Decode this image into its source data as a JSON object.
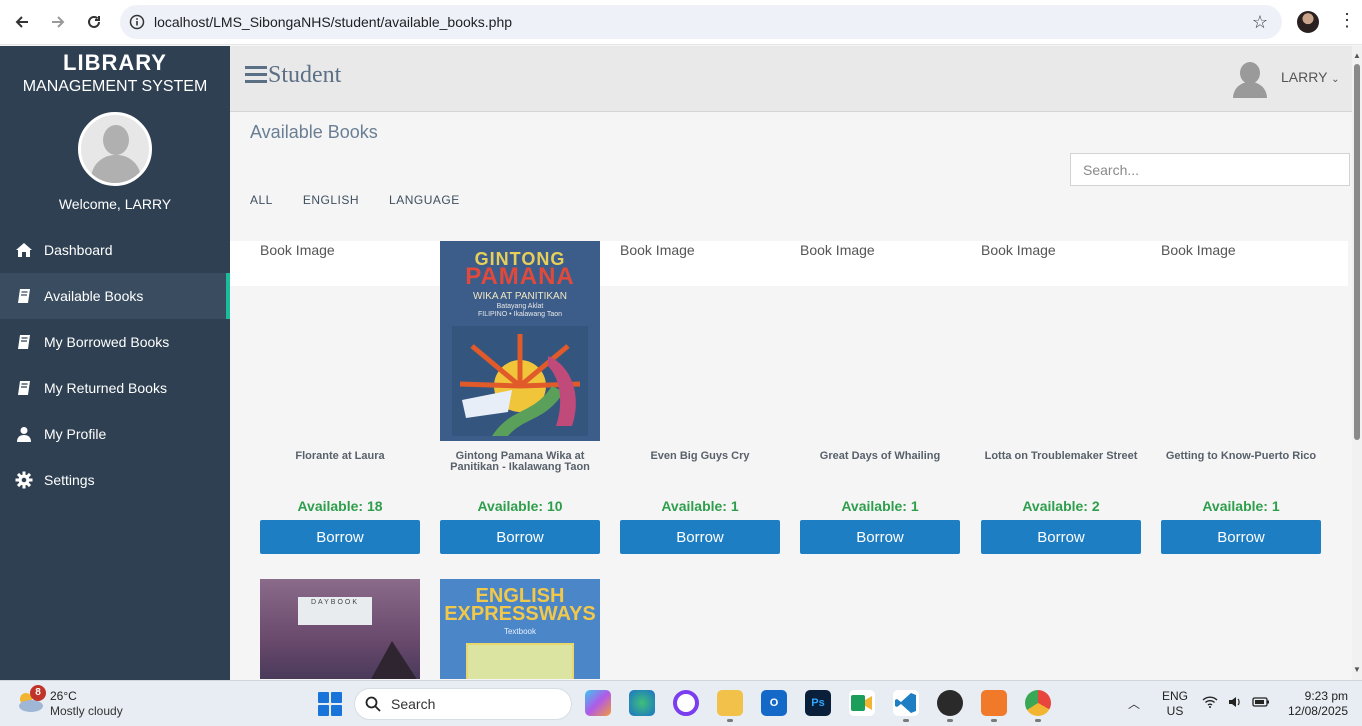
{
  "browser": {
    "url": "localhost/LMS_SibongaNHS/student/available_books.php"
  },
  "sidebar": {
    "brand_title": "LIBRARY",
    "brand_subtitle": "MANAGEMENT SYSTEM",
    "welcome": "Welcome, LARRY",
    "items": [
      {
        "label": "Dashboard",
        "icon": "home-icon",
        "active": false
      },
      {
        "label": "Available Books",
        "icon": "book-icon",
        "active": true
      },
      {
        "label": "My Borrowed Books",
        "icon": "book-icon",
        "active": false
      },
      {
        "label": "My Returned Books",
        "icon": "book-icon",
        "active": false
      },
      {
        "label": "My Profile",
        "icon": "user-icon",
        "active": false
      },
      {
        "label": "Settings",
        "icon": "gear-icon",
        "active": false
      }
    ]
  },
  "header": {
    "title": "Student",
    "user_name": "LARRY"
  },
  "main": {
    "page_title": "Available Books",
    "search_placeholder": "Search...",
    "filters": [
      "ALL",
      "ENGLISH",
      "LANGUAGE"
    ],
    "broken_image_alt": "Book Image",
    "borrow_label": "Borrow",
    "books": [
      {
        "title": "Florante at Laura",
        "available": "Available: 18",
        "cover": "broken"
      },
      {
        "title": "Gintong Pamana Wika at Panitikan - Ikalawang Taon",
        "available": "Available: 10",
        "cover": "gintong-pamana"
      },
      {
        "title": "Even Big Guys Cry",
        "available": "Available: 1",
        "cover": "broken"
      },
      {
        "title": "Great Days of Whailing",
        "available": "Available: 1",
        "cover": "broken"
      },
      {
        "title": "Lotta on Troublemaker Street",
        "available": "Available: 2",
        "cover": "broken"
      },
      {
        "title": "Getting to Know-Puerto Rico",
        "available": "Available: 1",
        "cover": "broken"
      }
    ],
    "covers": {
      "gintong_pamana": {
        "line1": "GINTONG",
        "line2": "PAMANA",
        "line3": "WIKA AT PANITIKAN",
        "line4": "Batayang Aklat",
        "line5": "FILIPINO • Ikalawang Taon"
      },
      "daybook": {
        "label": "DAYBOOK"
      },
      "english_expressways": {
        "line1": "ENGLISH",
        "line2": "EXPRESSWAYS",
        "line3": "Textbook"
      }
    }
  },
  "taskbar": {
    "weather_badge": "8",
    "temperature": "26°C",
    "weather_desc": "Mostly cloudy",
    "search_label": "Search",
    "lang_line1": "ENG",
    "lang_line2": "US",
    "time": "9:23 pm",
    "date": "12/08/2025"
  },
  "colors": {
    "sidebar_bg": "#2e4052",
    "accent": "#1abc9c",
    "borrow_button": "#1e7ec4",
    "available_text": "#2f9e4c"
  }
}
